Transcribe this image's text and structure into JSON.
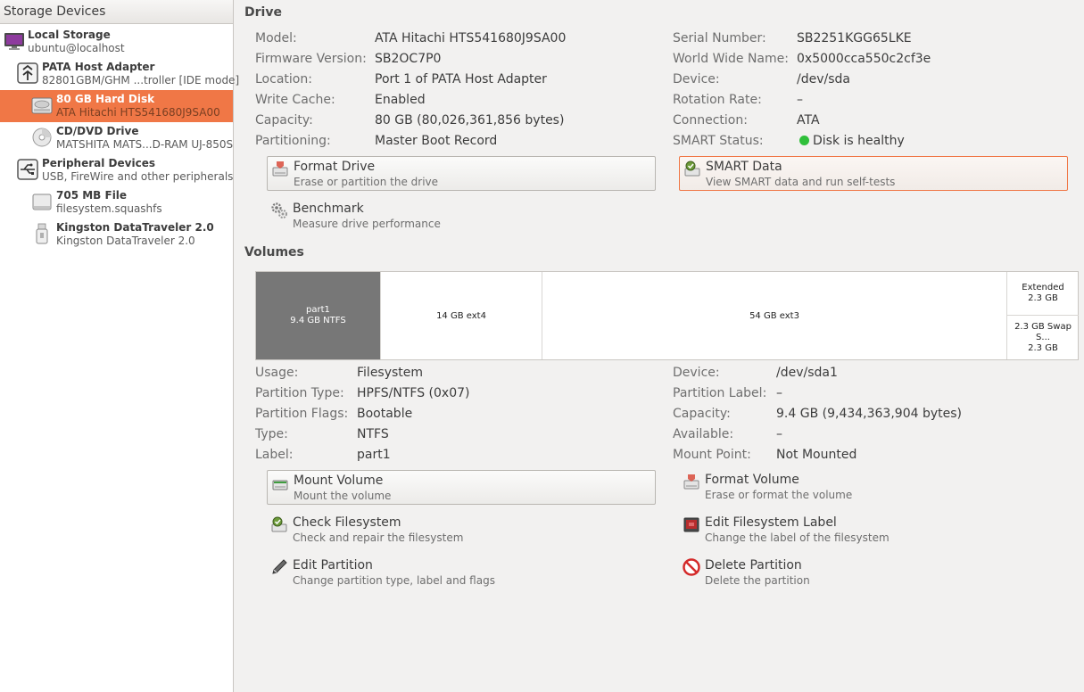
{
  "sidebar": {
    "header": "Storage Devices",
    "items": [
      {
        "name": "Local Storage",
        "sub": "ubuntu@localhost",
        "icon": "computer-icon"
      },
      {
        "name": "PATA Host Adapter",
        "sub": "82801GBM/GHM ...troller [IDE mode]",
        "icon": "host-adapter-icon"
      },
      {
        "name": "80 GB Hard Disk",
        "sub": "ATA Hitachi HTS541680J9SA00",
        "icon": "hard-disk-icon"
      },
      {
        "name": "CD/DVD Drive",
        "sub": "MATSHITA MATS...D-RAM UJ-850S",
        "icon": "optical-disc-icon"
      },
      {
        "name": "Peripheral Devices",
        "sub": "USB, FireWire and other peripherals",
        "icon": "usb-icon"
      },
      {
        "name": "705 MB File",
        "sub": "filesystem.squashfs",
        "icon": "file-drive-icon"
      },
      {
        "name": "Kingston DataTraveler 2.0",
        "sub": "Kingston DataTraveler 2.0",
        "icon": "usb-stick-icon"
      }
    ]
  },
  "drive": {
    "title": "Drive",
    "left": [
      {
        "label": "Model:",
        "value": "ATA Hitachi HTS541680J9SA00"
      },
      {
        "label": "Firmware Version:",
        "value": "SB2OC7P0"
      },
      {
        "label": "Location:",
        "value": "Port 1 of PATA Host Adapter"
      },
      {
        "label": "Write Cache:",
        "value": "Enabled"
      },
      {
        "label": "Capacity:",
        "value": "80 GB (80,026,361,856 bytes)"
      },
      {
        "label": "Partitioning:",
        "value": "Master Boot Record"
      }
    ],
    "right": [
      {
        "label": "Serial Number:",
        "value": "SB2251KGG65LKE"
      },
      {
        "label": "World Wide Name:",
        "value": "0x5000cca550c2cf3e"
      },
      {
        "label": "Device:",
        "value": "/dev/sda"
      },
      {
        "label": "Rotation Rate:",
        "value": "–"
      },
      {
        "label": "Connection:",
        "value": "ATA"
      },
      {
        "label": "SMART Status:",
        "value": "Disk is healthy"
      }
    ],
    "actions": {
      "format": {
        "title": "Format Drive",
        "desc": "Erase or partition the drive"
      },
      "smart": {
        "title": "SMART Data",
        "desc": "View SMART data and run self-tests"
      },
      "benchmark": {
        "title": "Benchmark",
        "desc": "Measure drive performance"
      }
    },
    "colors": {
      "health": "#2fbf3a",
      "accent": "#f07746"
    }
  },
  "volumes": {
    "title": "Volumes",
    "segments": [
      {
        "line1": "part1",
        "line2": "9.4 GB NTFS"
      },
      {
        "line1": "14 GB ext4"
      },
      {
        "line1": "54 GB ext3"
      }
    ],
    "extended": {
      "line1": "Extended",
      "line2": "2.3 GB"
    },
    "swap": {
      "line1": "2.3 GB Swap S...",
      "line2": "2.3 GB"
    },
    "left": [
      {
        "label": "Usage:",
        "value": "Filesystem"
      },
      {
        "label": "Partition Type:",
        "value": "HPFS/NTFS (0x07)"
      },
      {
        "label": "Partition Flags:",
        "value": "Bootable"
      },
      {
        "label": "Type:",
        "value": "NTFS"
      },
      {
        "label": "Label:",
        "value": "part1"
      }
    ],
    "right": [
      {
        "label": "Device:",
        "value": "/dev/sda1"
      },
      {
        "label": "Partition Label:",
        "value": "–"
      },
      {
        "label": "Capacity:",
        "value": "9.4 GB (9,434,363,904 bytes)"
      },
      {
        "label": "Available:",
        "value": "–"
      },
      {
        "label": "Mount Point:",
        "value": "Not Mounted"
      }
    ],
    "actions": {
      "mount": {
        "title": "Mount Volume",
        "desc": "Mount the volume"
      },
      "format": {
        "title": "Format Volume",
        "desc": "Erase or format the volume"
      },
      "check": {
        "title": "Check Filesystem",
        "desc": "Check and repair the filesystem"
      },
      "label": {
        "title": "Edit Filesystem Label",
        "desc": "Change the label of the filesystem"
      },
      "edit": {
        "title": "Edit Partition",
        "desc": "Change partition type, label and flags"
      },
      "delete": {
        "title": "Delete Partition",
        "desc": "Delete the partition"
      }
    }
  }
}
